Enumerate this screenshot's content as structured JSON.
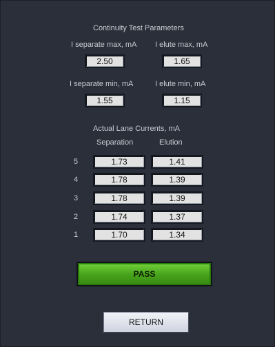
{
  "params": {
    "title": "Continuity Test Parameters",
    "sep_max_label": "I separate max, mA",
    "elute_max_label": "I elute max, mA",
    "sep_max_value": "2.50",
    "elute_max_value": "1.65",
    "sep_min_label": "I separate min, mA",
    "elute_min_label": "I elute min, mA",
    "sep_min_value": "1.55",
    "elute_min_value": "1.15"
  },
  "currents": {
    "title": "Actual Lane Currents, mA",
    "col_separation": "Separation",
    "col_elution": "Elution",
    "lanes": [
      {
        "lane": "5",
        "separation": "1.73",
        "elution": "1.41"
      },
      {
        "lane": "4",
        "separation": "1.78",
        "elution": "1.39"
      },
      {
        "lane": "3",
        "separation": "1.78",
        "elution": "1.39"
      },
      {
        "lane": "2",
        "separation": "1.74",
        "elution": "1.37"
      },
      {
        "lane": "1",
        "separation": "1.70",
        "elution": "1.34"
      }
    ]
  },
  "status_button": "PASS",
  "return_button": "RETURN",
  "colors": {
    "background": "#2b2f3a",
    "pass_green": "#46a21a",
    "field_bg": "#e2e2e2"
  }
}
